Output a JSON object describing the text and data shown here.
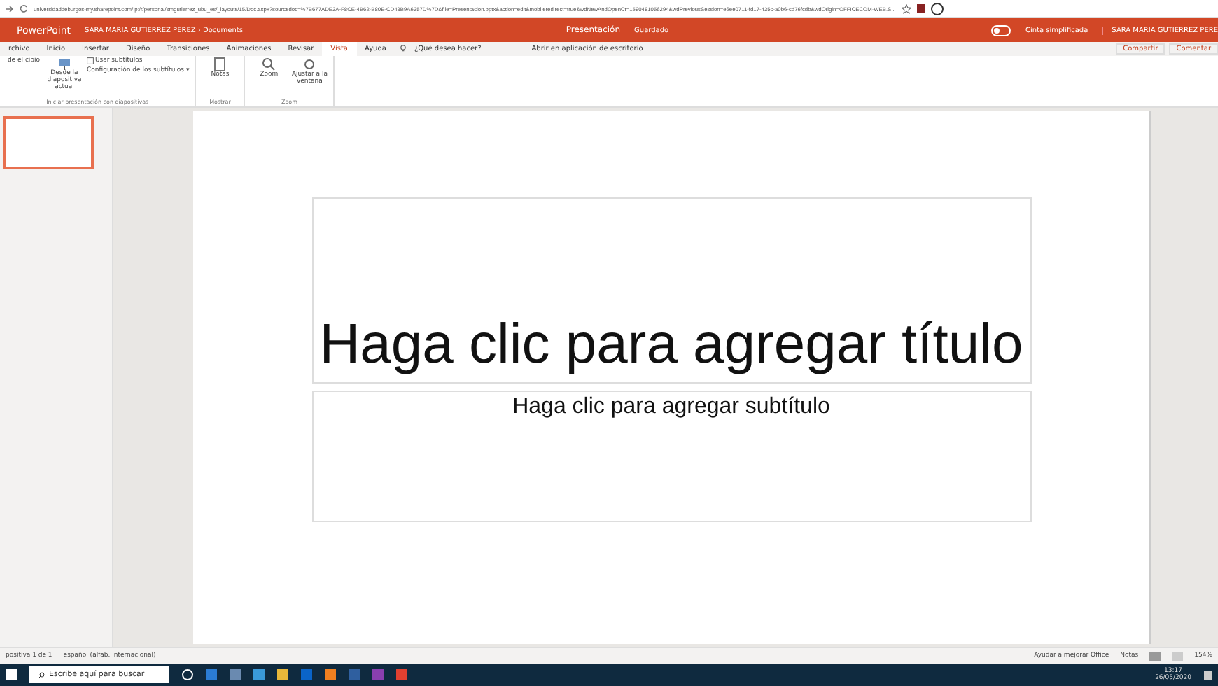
{
  "browser": {
    "url": "universidaddeburgos-my.sharepoint.com/:p:/r/personal/smgutierrez_ubu_es/_layouts/15/Doc.aspx?sourcedoc=%7B677ADE3A-F8CE-4B62-B80E-CD43B9A6357D%7D&file=Presentacion.pptx&action=edit&mobileredirect=true&wdNewAndOpenCt=1590481056294&wdPreviousSession=e6ee0711-fd17-435c-a0b6-cd76fcdb&wdOrigin=OFFICECOM-WEB.S..."
  },
  "titlebar": {
    "app": "PowerPoint",
    "path": "SARA MARIA GUTIERREZ PEREZ › Documents",
    "doc": "Presentación",
    "status": "Guardado",
    "toggle_label": "Cinta simplificada",
    "toggle_on": false,
    "user": "SARA MARIA GUTIERREZ PERE"
  },
  "tabs": [
    {
      "label": "rchivo",
      "selected": false
    },
    {
      "label": "Inicio",
      "selected": false
    },
    {
      "label": "Insertar",
      "selected": false
    },
    {
      "label": "Diseño",
      "selected": false
    },
    {
      "label": "Transiciones",
      "selected": false
    },
    {
      "label": "Animaciones",
      "selected": false
    },
    {
      "label": "Revisar",
      "selected": false
    },
    {
      "label": "Vista",
      "selected": true
    },
    {
      "label": "Ayuda",
      "selected": false
    }
  ],
  "tell_me": "¿Qué desea hacer?",
  "open_desktop": "Abrir en aplicación de escritorio",
  "share": "Compartir",
  "comments": "Comentar",
  "ribbon": {
    "start_cut": "de el cipio",
    "from_current": "Desde la diapositiva actual",
    "use_subtitles": "Usar subtítulos",
    "use_subtitles_checked": false,
    "subtitle_settings": "Configuración de los subtítulos ▾",
    "group_start": "Iniciar presentación con diapositivas",
    "notes": "Notas",
    "group_show": "Mostrar",
    "zoom": "Zoom",
    "fit": "Ajustar a la ventana",
    "group_zoom": "Zoom"
  },
  "slide": {
    "title": "Haga clic para agregar título",
    "subtitle": "Haga clic para agregar subtítulo"
  },
  "status": {
    "slide": "positiva 1 de 1",
    "language": "español (alfab. internacional)",
    "help": "Ayudar a mejorar Office",
    "notes": "Notas",
    "zoom": "154%"
  },
  "taskbar": {
    "search": "Escribe aquí para buscar",
    "time": "13:17",
    "date": "26/05/2020"
  }
}
